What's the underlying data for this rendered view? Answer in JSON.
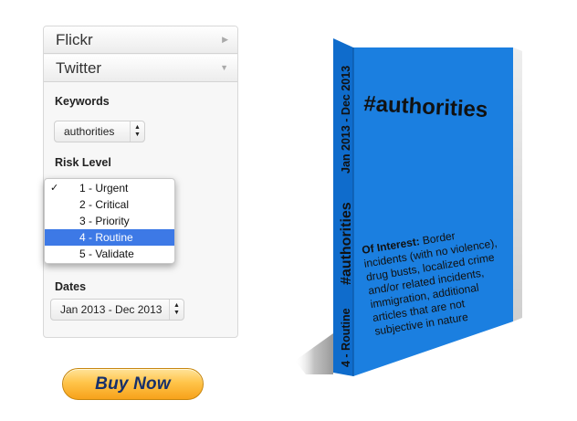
{
  "sidebar": {
    "flickr_label": "Flickr",
    "twitter_label": "Twitter",
    "keywords_label": "Keywords",
    "keywords_value": "authorities",
    "risk_label": "Risk Level",
    "risk_options": [
      "1 - Urgent",
      "2 - Critical",
      "3 - Priority",
      "4 - Routine",
      "5 - Validate"
    ],
    "risk_selected": "4 - Routine",
    "check_mark": "✓",
    "dates_label": "Dates",
    "dates_value": "Jan 2013 - Dec 2013"
  },
  "buy_button": {
    "label": "Buy Now"
  },
  "book": {
    "title": "#authorities",
    "spine_top": "Jan 2013 - Dec 2013",
    "spine_middle": "#authorities",
    "spine_bottom": "4 - Routine",
    "interest_heading": "Of Interest:",
    "interest_lines": [
      " Border",
      "incidents (with no violence),",
      "drug busts, localized crime",
      "and/or related incidents,",
      "immigration, additional",
      "articles that are not",
      "subjective in nature"
    ]
  },
  "colors": {
    "book_cover": "#1b7fe0",
    "selected_option": "#3d79e6",
    "button_text": "#16306b"
  }
}
